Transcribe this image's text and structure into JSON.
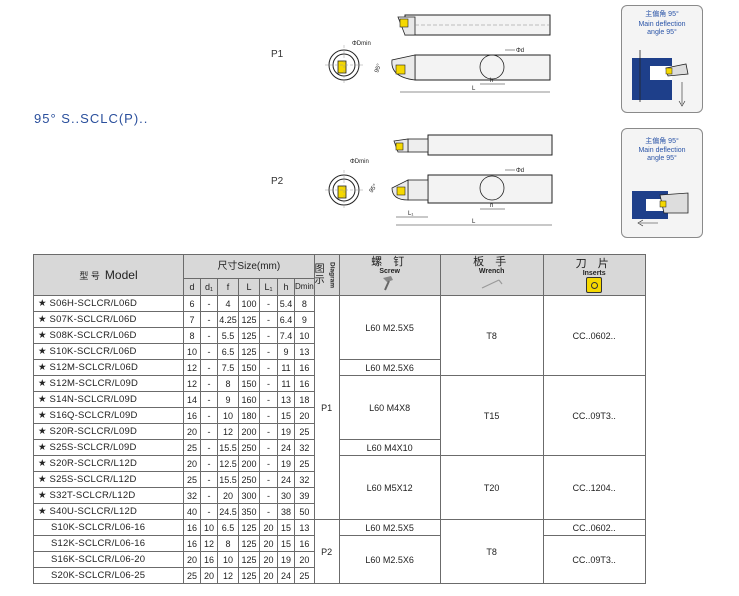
{
  "series_title": "95° S..SCLC(P)..",
  "p1_label": "P1",
  "p2_label": "P2",
  "drawing_labels": {
    "dmin": "ΦDmin",
    "d": "Φd",
    "angle": "95°",
    "h": "h",
    "L": "L",
    "L1": "L₁"
  },
  "angle_box_1": {
    "cn": "主偏角 95°",
    "en1": "Main deflection",
    "en2": "angle 95°"
  },
  "angle_box_2": {
    "cn": "主偏角 95°",
    "en1": "Main deflection",
    "en2": "angle 95°"
  },
  "table": {
    "header_model_cn": "型  号",
    "header_model_en": "Model",
    "header_size": "尺寸Size(mm)",
    "cols": [
      "d",
      "d₁",
      "f",
      "L",
      "L₁",
      "h",
      "Dmin"
    ],
    "diagram_cn": "图示",
    "diagram_en": "Diagram",
    "screw_cn": "螺 钉",
    "screw_en": "Screw",
    "wrench_cn": "板 手",
    "wrench_en": "Wrench",
    "inserts_cn": "刀 片",
    "inserts_en": "Inserts",
    "rows": [
      {
        "model": "★ S06H-SCLCR/L06D",
        "v": [
          "6",
          "-",
          "4",
          "100",
          "-",
          "5.4",
          "8"
        ]
      },
      {
        "model": "★ S07K-SCLCR/L06D",
        "v": [
          "7",
          "-",
          "4.25",
          "125",
          "-",
          "6.4",
          "9"
        ]
      },
      {
        "model": "★ S08K-SCLCR/L06D",
        "v": [
          "8",
          "-",
          "5.5",
          "125",
          "-",
          "7.4",
          "10"
        ]
      },
      {
        "model": "★ S10K-SCLCR/L06D",
        "v": [
          "10",
          "-",
          "6.5",
          "125",
          "-",
          "9",
          "13"
        ]
      },
      {
        "model": "★ S12M-SCLCR/L06D",
        "v": [
          "12",
          "-",
          "7.5",
          "150",
          "-",
          "11",
          "16"
        ]
      },
      {
        "model": "★ S12M-SCLCR/L09D",
        "v": [
          "12",
          "-",
          "8",
          "150",
          "-",
          "11",
          "16"
        ]
      },
      {
        "model": "★ S14N-SCLCR/L09D",
        "v": [
          "14",
          "-",
          "9",
          "160",
          "-",
          "13",
          "18"
        ]
      },
      {
        "model": "★ S16Q-SCLCR/L09D",
        "v": [
          "16",
          "-",
          "10",
          "180",
          "-",
          "15",
          "20"
        ]
      },
      {
        "model": "★ S20R-SCLCR/L09D",
        "v": [
          "20",
          "-",
          "12",
          "200",
          "-",
          "19",
          "25"
        ]
      },
      {
        "model": "★ S25S-SCLCR/L09D",
        "v": [
          "25",
          "-",
          "15.5",
          "250",
          "-",
          "24",
          "32"
        ]
      },
      {
        "model": "★ S20R-SCLCR/L12D",
        "v": [
          "20",
          "-",
          "12.5",
          "200",
          "-",
          "19",
          "25"
        ]
      },
      {
        "model": "★ S25S-SCLCR/L12D",
        "v": [
          "25",
          "-",
          "15.5",
          "250",
          "-",
          "24",
          "32"
        ]
      },
      {
        "model": "★ S32T-SCLCR/L12D",
        "v": [
          "32",
          "-",
          "20",
          "300",
          "-",
          "30",
          "39"
        ]
      },
      {
        "model": "★ S40U-SCLCR/L12D",
        "v": [
          "40",
          "-",
          "24.5",
          "350",
          "-",
          "38",
          "50"
        ]
      },
      {
        "model": "S10K-SCLCR/L06-16",
        "v": [
          "16",
          "10",
          "6.5",
          "125",
          "20",
          "15",
          "13"
        ]
      },
      {
        "model": "S12K-SCLCR/L06-16",
        "v": [
          "16",
          "12",
          "8",
          "125",
          "20",
          "15",
          "16"
        ]
      },
      {
        "model": "S16K-SCLCR/L06-20",
        "v": [
          "20",
          "16",
          "10",
          "125",
          "20",
          "19",
          "20"
        ]
      },
      {
        "model": "S20K-SCLCR/L06-25",
        "v": [
          "25",
          "20",
          "12",
          "125",
          "20",
          "24",
          "25"
        ]
      }
    ],
    "diagram_p1": "P1",
    "diagram_p2": "P2",
    "screws": [
      "L60 M2.5X5",
      "L60 M2.5X6",
      "L60 M4X8",
      "L60 M4X10",
      "L60 M5X12",
      "L60 M2.5X5",
      "L60 M2.5X6"
    ],
    "wrenches": [
      "T8",
      "T15",
      "T20",
      "T8"
    ],
    "inserts": [
      "CC..0602..",
      "CC..09T3..",
      "CC..1204..",
      "CC..0602..",
      "CC..09T3.."
    ]
  }
}
